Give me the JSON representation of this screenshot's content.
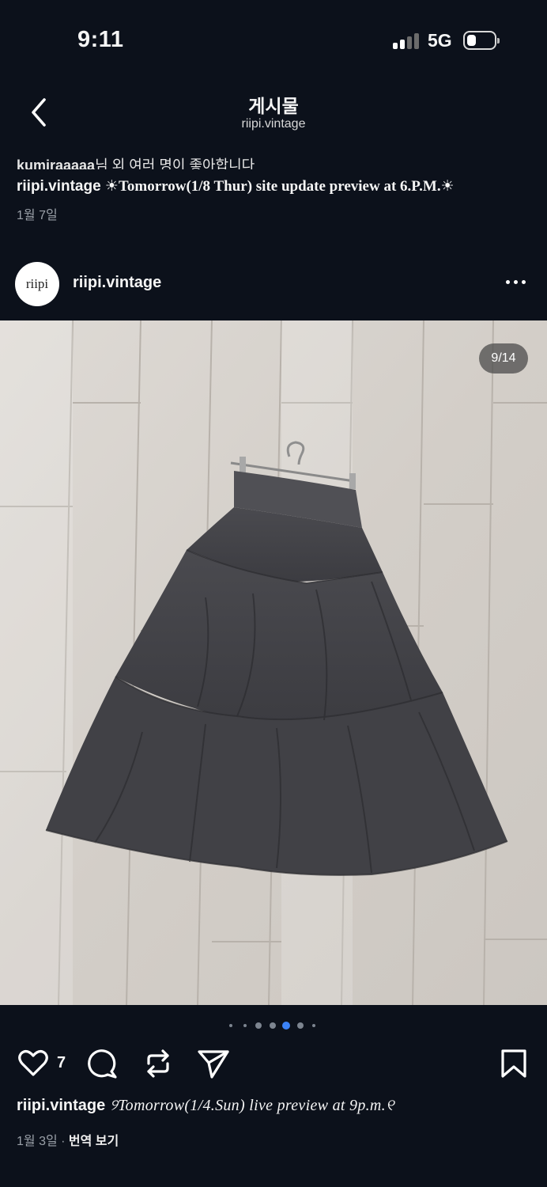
{
  "status_bar": {
    "time": "9:11",
    "network": "5G",
    "signal_bars_active": 2,
    "battery_level": 0.2
  },
  "header": {
    "title": "게시물",
    "account": "riipi.vintage",
    "back_icon": "chevron-left-icon"
  },
  "previous_post": {
    "comment_user": "kumiraaaaa",
    "comment_text": "님 외 여러 명이 좋아합니다",
    "caption_user": "riipi.vintage",
    "caption_text": "☀Tomorrow(1/8 Thur) site update preview at 6.P.M.☀",
    "date": "1월 7일"
  },
  "post": {
    "avatar_text": "riipi",
    "username": "riipi.vintage",
    "more_icon": "more-horizontal-icon",
    "image_counter": "9/14",
    "carousel_total_dots": 7,
    "carousel_active_dot": 4,
    "likes_count": "7",
    "caption_user": "riipi.vintage",
    "caption_text": "୨Tomorrow(1/4.Sun) live preview at 9p.m.୧",
    "date": "1월 3일",
    "separator": "·",
    "translate_label": "번역 보기"
  },
  "actions": {
    "like_icon": "heart-icon",
    "comment_icon": "comment-icon",
    "repost_icon": "repost-icon",
    "share_icon": "send-icon",
    "save_icon": "bookmark-icon"
  },
  "colors": {
    "background": "#0c111b",
    "text": "#f5f5f5",
    "muted": "#9aa0a8",
    "active_dot": "#3b82f6"
  }
}
